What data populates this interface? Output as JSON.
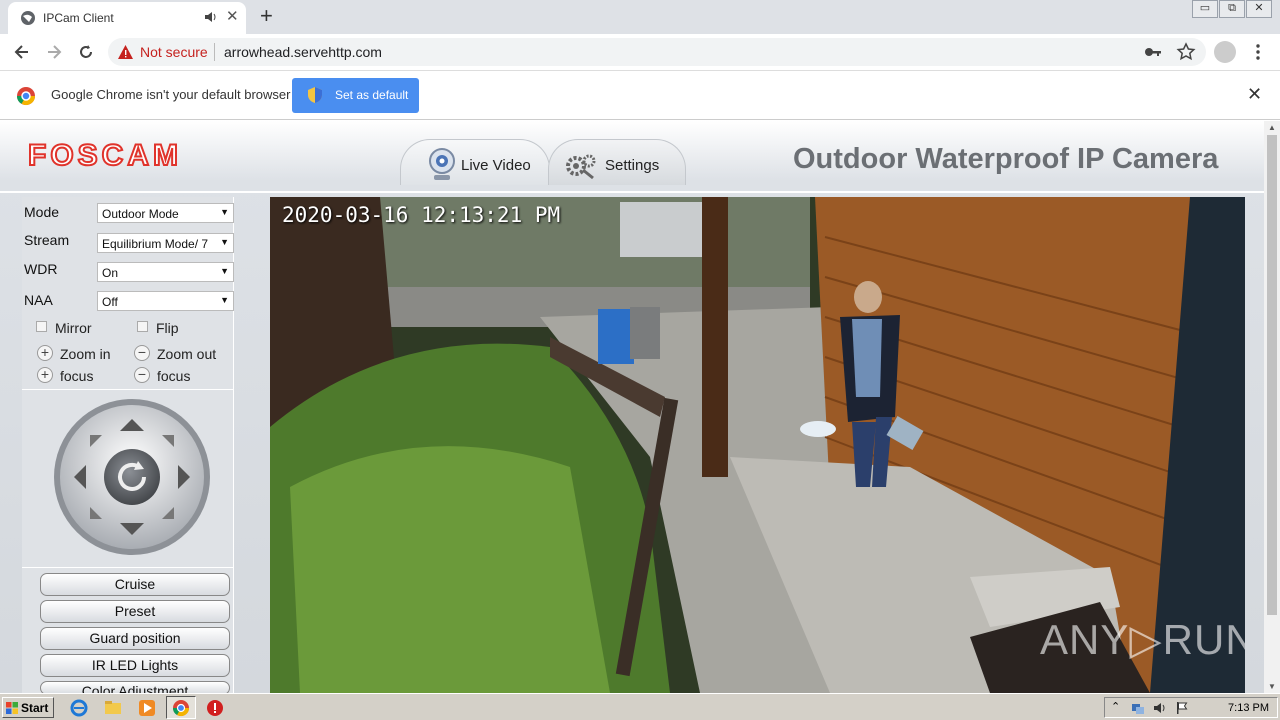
{
  "browser": {
    "tab_title": "IPCam Client",
    "new_tab": "+",
    "security_label": "Not secure",
    "url": "arrowhead.servehttp.com",
    "infobar_text": "Google Chrome isn't your default browser",
    "infobar_button": "Set as default",
    "infobar_close": "✕",
    "tab_close": "✕"
  },
  "window": {
    "minimize": "▭",
    "restore": "⧉",
    "close": "✕"
  },
  "page": {
    "logo": "FOSCAM",
    "product_title": "Outdoor Waterproof IP Camera",
    "tabs": [
      {
        "label": "Live Video",
        "icon": "webcam-icon",
        "active": true
      },
      {
        "label": "Settings",
        "icon": "gears-icon",
        "active": false
      }
    ]
  },
  "controls": {
    "mode_label": "Mode",
    "mode_value": "Outdoor Mode",
    "stream_label": "Stream",
    "stream_value": "Equilibrium Mode/ 7",
    "wdr_label": "WDR",
    "wdr_value": "On",
    "naa_label": "NAA",
    "naa_value": "Off",
    "mirror_label": "Mirror",
    "flip_label": "Flip",
    "zoom_in_label": "Zoom in",
    "zoom_out_label": "Zoom out",
    "focus_in_label": "focus",
    "focus_out_label": "focus",
    "plus_sign": "+",
    "minus_sign": "−",
    "dropdown_arrow": "▼",
    "buttons": [
      "Cruise",
      "Preset",
      "Guard position",
      "IR LED Lights",
      "Color Adjustment"
    ]
  },
  "video": {
    "timestamp": "2020-03-16 12:13:21 PM",
    "watermark": "ANY▷RUN"
  },
  "taskbar": {
    "start_label": "Start",
    "clock": "7:13 PM"
  },
  "colors": {
    "foscam_red": "#e0332b",
    "chrome_blue": "#4a8ef0",
    "not_secure_red": "#c5221f"
  }
}
